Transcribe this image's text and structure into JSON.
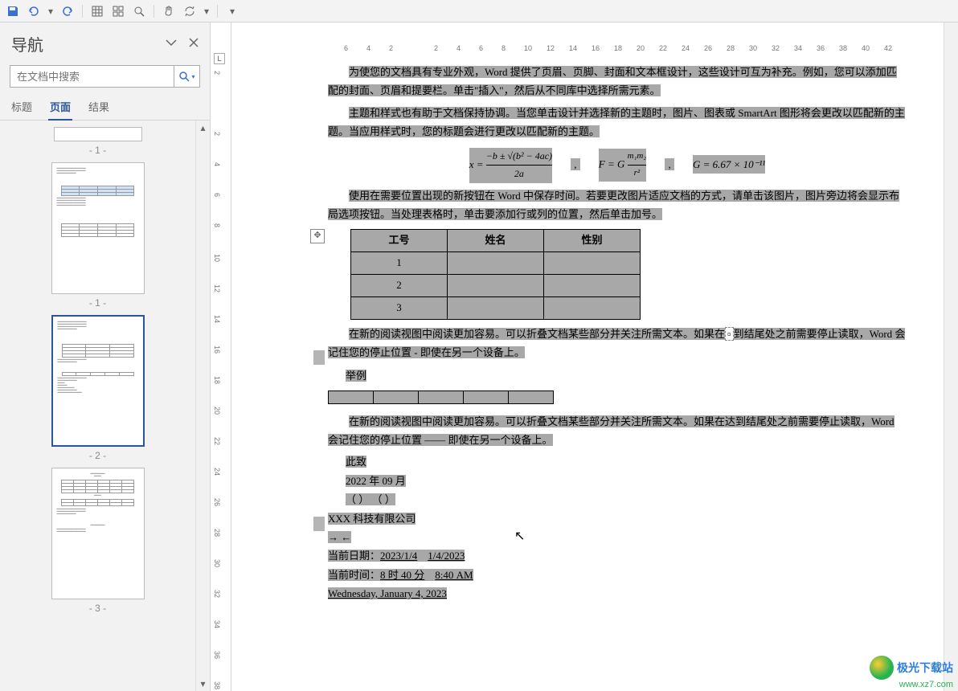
{
  "toolbar": {
    "save": "保存",
    "undo": "撤销",
    "redo": "重做"
  },
  "nav": {
    "title": "导航",
    "search_placeholder": "在文档中搜索",
    "tabs": {
      "headings": "标题",
      "pages": "页面",
      "results": "结果"
    },
    "thumb_labels": {
      "p1a": "- 1 -",
      "p1b": "- 1 -",
      "p2": "- 2 -",
      "p3": "- 3 -"
    }
  },
  "ruler": {
    "h": [
      "6",
      "4",
      "2",
      "",
      "2",
      "4",
      "6",
      "8",
      "10",
      "12",
      "14",
      "16",
      "18",
      "20",
      "22",
      "24",
      "26",
      "28",
      "30",
      "32",
      "34",
      "36",
      "38",
      "40",
      "42"
    ],
    "v": [
      "|2|",
      "",
      "|2|",
      "|4|",
      "|6|",
      "|8|",
      "|10|",
      "|12|",
      "|14|",
      "|16|",
      "|18|",
      "|20|",
      "|22|",
      "|24|",
      "|26|",
      "|28|",
      "|30|",
      "|32|",
      "|34|",
      "|36|",
      "|38|"
    ],
    "tab": "L"
  },
  "doc": {
    "p1": "为使您的文档具有专业外观，Word 提供了页眉、页脚、封面和文本框设计，这些设计可互为补充。例如，您可以添加匹配的封面、页眉和提要栏。单击\"插入\"，然后从不同库中选择所需元素。",
    "p2": "主题和样式也有助于文档保持协调。当您单击设计并选择新的主题时，图片、图表或 SmartArt 图形将会更改以匹配新的主题。当应用样式时，您的标题会进行更改以匹配新的主题。",
    "formula1_lhs": "x =",
    "formula1_top": "−b ± √(b² − 4ac)",
    "formula1_bot": "2a",
    "formula2": "F = G",
    "formula2_top": "m₁m₂",
    "formula2_bot": "r²",
    "formula3": "G = 6.67 × 10⁻¹¹",
    "p3": "使用在需要位置出现的新按钮在 Word 中保存时间。若要更改图片适应文档的方式，请单击该图片，图片旁边将会显示布局选项按钮。当处理表格时，单击要添加行或列的位置，然后单击加号。",
    "tbl1": {
      "h1": "工号",
      "h2": "姓名",
      "h3": "性别",
      "r1": "1",
      "r2": "2",
      "r3": "3"
    },
    "p4a": "在新的阅读视图中阅读更加容易。可以折叠文档某些部分并关注所需文本。如果在",
    "p4b": "到结尾处之前需要停止读取，Word 会记住您的停止位置 - 即使在另一个设备上。",
    "ex": "举例",
    "p5": "在新的阅读视图中阅读更加容易。可以折叠文档某些部分并关注所需文本。如果在达到结尾处之前需要停止读取，Word 会记住您的停止位置 —— 即使在另一个设备上。",
    "sig1": "此致",
    "sig2": "2022 年 09 月",
    "sig3": "（  ） （  ）",
    "sig4": "XXX 科技有限公司",
    "arrows": "→ ←",
    "dt1_label": "当前日期：",
    "dt1_a": "2023/1/4",
    "dt1_b": "1/4/2023",
    "dt2_label": "当前时间：",
    "dt2_a": "8 时 40 分",
    "dt2_b": "8:40 AM",
    "dt3": "Wednesday, January 4, 2023"
  },
  "watermark": {
    "name": "极光下载站",
    "url": "www.xz7.com"
  }
}
